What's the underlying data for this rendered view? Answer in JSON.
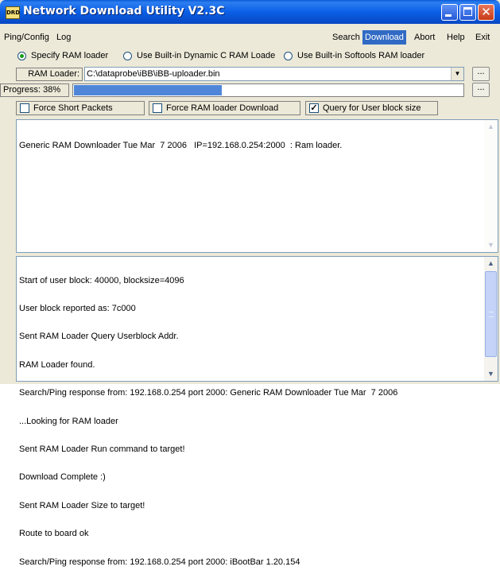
{
  "titlebar": {
    "icon_text": "DRD",
    "title": "Network Download Utility V2.3C",
    "close_glyph": "✕"
  },
  "menu": {
    "left": [
      "Ping/Config",
      "Log"
    ],
    "right": [
      "Search",
      "Download",
      "Abort",
      "Help",
      "Exit"
    ],
    "active": "Download"
  },
  "loader_options": {
    "items": [
      "Specify RAM loader",
      "Use Built-in Dynamic C RAM Loade",
      "Use Built-in Softools RAM loader"
    ],
    "selected_index": 0
  },
  "ram_loader": {
    "label": "RAM Loader:",
    "path": "C:\\dataprobe\\iBB\\iBB-uploader.bin",
    "browse_label": "...",
    "dropdown_glyph": "▼"
  },
  "progress": {
    "label": "Progress: 38%",
    "percent": 38,
    "button_label": "..."
  },
  "options": {
    "force_short_packets": {
      "label": "Force Short Packets",
      "checked": false
    },
    "force_ram_loader": {
      "label": "Force RAM loader Download",
      "checked": false
    },
    "query_user_block": {
      "label": "Query for User block size",
      "checked": true
    }
  },
  "response_panel": {
    "lines": [
      "Generic RAM Downloader Tue Mar  7 2006   IP=192.168.0.254:2000  : Ram loader."
    ]
  },
  "log_panel": {
    "lines": [
      "Start of user block: 40000, blocksize=4096",
      "User block reported as: 7c000",
      "Sent RAM Loader Query Userblock Addr.",
      "RAM Loader found.",
      "Search/Ping response from: 192.168.0.254 port 2000: Generic RAM Downloader Tue Mar  7 2006",
      "...Looking for RAM loader",
      "Sent RAM Loader Run command to target!",
      "Download Complete :)",
      "Sent RAM Loader Size to target!",
      "Route to board ok",
      "Search/Ping response from: 192.168.0.254 port 2000: iBootBar 1.20.154"
    ]
  },
  "scroll_glyphs": {
    "up": "▲",
    "down": "▼"
  },
  "colors": {
    "title_blue": "#0b5fe6",
    "menu_highlight": "#316ac5",
    "progress_fill": "#4f86d8"
  }
}
